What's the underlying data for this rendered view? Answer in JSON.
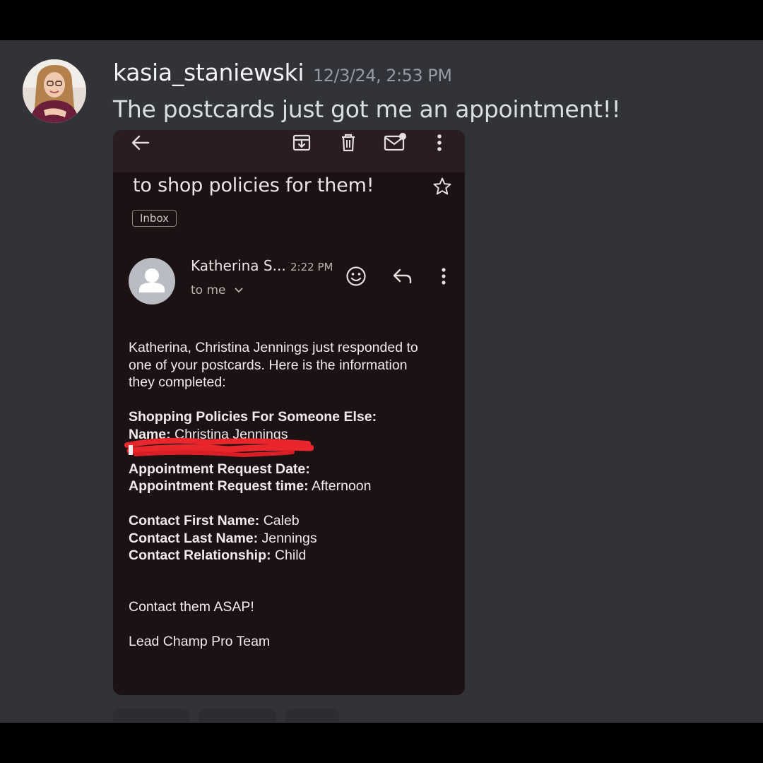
{
  "post": {
    "username": "kasia_staniewski",
    "timestamp": "12/3/24, 2:53 PM",
    "message": "The postcards just got me an appointment!!",
    "avatar_icon": "user-photo"
  },
  "email": {
    "toolbar_icons": [
      "back-arrow-icon",
      "archive-icon",
      "trash-icon",
      "mark-unread-icon",
      "more-vert-icon"
    ],
    "subject": "to shop policies for them!",
    "label": "Inbox",
    "sender": {
      "name": "Katherina S...",
      "time": "2:22 PM",
      "recipient": "to me"
    },
    "body": {
      "intro_lines": [
        "Katherina, Christina Jennings just responded to",
        "one of your postcards. Here is the information",
        "they completed:"
      ],
      "section_heading": "Shopping Policies For Someone Else:",
      "fields": {
        "name_label": "Name:",
        "name_value": "Christina Jennings",
        "appt_date_label": "Appointment Request Date:",
        "appt_time_label": "Appointment Request time:",
        "appt_time_value": "Afternoon",
        "first_name_label": "Contact First Name:",
        "first_name_value": "Caleb",
        "last_name_label": "Contact Last Name:",
        "last_name_value": "Jennings",
        "relationship_label": "Contact Relationship:",
        "relationship_value": "Child"
      },
      "cta": "Contact them ASAP!",
      "signature": "Lead Champ Pro Team"
    }
  },
  "colors": {
    "chat_bg": "#313338",
    "email_bg": "#1c1214",
    "redaction": "#e8262b"
  }
}
